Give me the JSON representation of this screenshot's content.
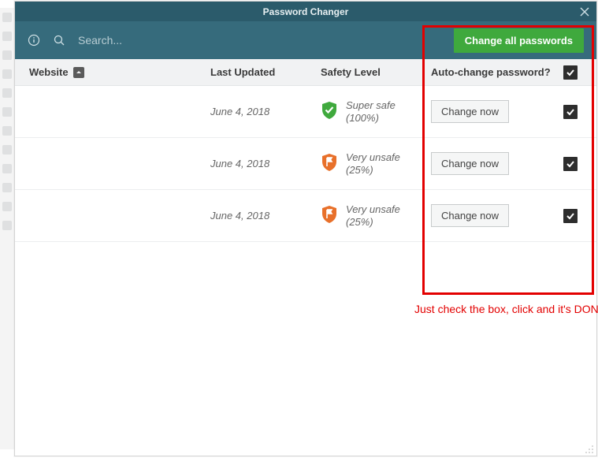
{
  "titlebar": {
    "title": "Password Changer"
  },
  "toolbar": {
    "search_placeholder": "Search...",
    "change_all_label": "Change all passwords"
  },
  "columns": {
    "website": "Website",
    "last_updated": "Last Updated",
    "safety": "Safety Level",
    "auto": "Auto-change password?"
  },
  "rows": [
    {
      "date": "June 4, 2018",
      "safety_label": "Super safe",
      "safety_pct": "(100%)",
      "safety_color": "#3fa93d",
      "safety_icon": "shield-check",
      "change_label": "Change now",
      "checked": true
    },
    {
      "date": "June 4, 2018",
      "safety_label": "Very unsafe",
      "safety_pct": "(25%)",
      "safety_color": "#e8702a",
      "safety_icon": "shield-flag",
      "change_label": "Change now",
      "checked": true
    },
    {
      "date": "June 4, 2018",
      "safety_label": "Very unsafe",
      "safety_pct": "(25%)",
      "safety_color": "#e8702a",
      "safety_icon": "shield-flag",
      "change_label": "Change now",
      "checked": true
    }
  ],
  "annotation": {
    "caption": "Just check the box, click and it's DONE!"
  },
  "header_checked": true
}
